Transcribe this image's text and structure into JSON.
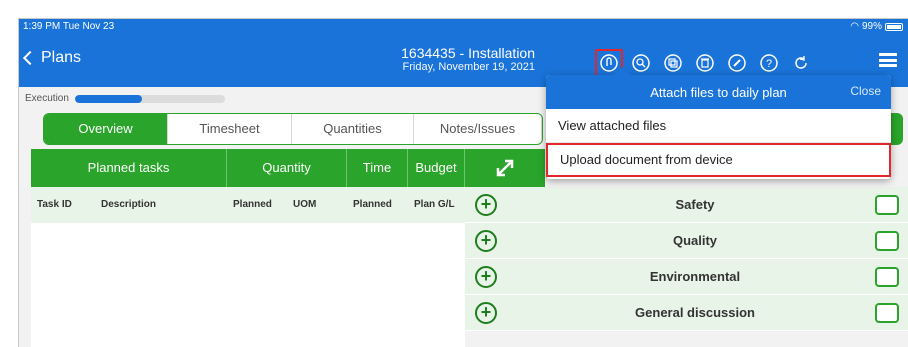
{
  "status": {
    "time": "1:39 PM  Tue Nov 23",
    "battery": "99%"
  },
  "header": {
    "back_label": "Plans",
    "title": "1634435 - Installation",
    "subtitle": "Friday, November 19, 2021",
    "toolbar_icons": [
      "attach-icon",
      "search-doc-icon",
      "copy-icon",
      "delete-icon",
      "edit-pen-icon",
      "help-icon",
      "refresh-icon"
    ]
  },
  "execution": {
    "label": "Execution",
    "progress": 0.45
  },
  "tabs": [
    {
      "label": "Overview",
      "active": true
    },
    {
      "label": "Timesheet",
      "active": false
    },
    {
      "label": "Quantities",
      "active": false
    },
    {
      "label": "Notes/Issues",
      "active": false
    }
  ],
  "table": {
    "groups": [
      "Planned tasks",
      "Quantity",
      "Time",
      "Budget"
    ],
    "columns": [
      "Task ID",
      "Description",
      "Planned",
      "UOM",
      "Planned",
      "Plan G/L"
    ]
  },
  "categories": [
    "Safety",
    "Quality",
    "Environmental",
    "General discussion"
  ],
  "popover": {
    "title": "Attach files to daily plan",
    "close_label": "Close",
    "items": [
      "View attached files",
      "Upload document from device"
    ]
  },
  "colors": {
    "header_blue": "#1a73d8",
    "green": "#2aa42a",
    "highlight_red": "#e0282c"
  }
}
